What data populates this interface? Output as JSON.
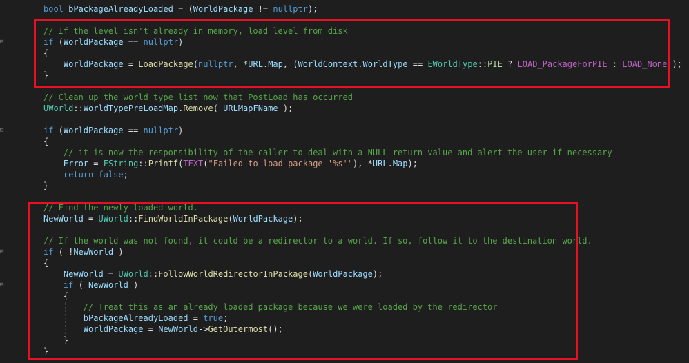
{
  "editor": {
    "highlight_color": "#e81123",
    "background_color": "#1e1e1e",
    "fold_icon": "fold-minus-icon",
    "lines": [
      {
        "tokens": [
          {
            "c": "kw",
            "t": "bool"
          },
          {
            "c": "pl",
            "t": " "
          },
          {
            "c": "id",
            "t": "bPackageAlreadyLoaded"
          },
          {
            "c": "pl",
            "t": " = ("
          },
          {
            "c": "id",
            "t": "WorldPackage"
          },
          {
            "c": "pl",
            "t": " != "
          },
          {
            "c": "kw",
            "t": "nullptr"
          },
          {
            "c": "pl",
            "t": ");"
          }
        ]
      },
      {
        "tokens": []
      },
      {
        "tokens": [
          {
            "c": "cm",
            "t": "// If the level isn't already in memory, load level from disk"
          }
        ]
      },
      {
        "tokens": [
          {
            "c": "kw",
            "t": "if"
          },
          {
            "c": "pl",
            "t": " ("
          },
          {
            "c": "id",
            "t": "WorldPackage"
          },
          {
            "c": "pl",
            "t": " == "
          },
          {
            "c": "kw",
            "t": "nullptr"
          },
          {
            "c": "pl",
            "t": ")"
          }
        ]
      },
      {
        "tokens": [
          {
            "c": "pl",
            "t": "{"
          }
        ]
      },
      {
        "tokens": [
          {
            "c": "pl",
            "t": "    "
          },
          {
            "c": "id",
            "t": "WorldPackage"
          },
          {
            "c": "pl",
            "t": " = "
          },
          {
            "c": "fn",
            "t": "LoadPackage"
          },
          {
            "c": "pl",
            "t": "("
          },
          {
            "c": "kw",
            "t": "nullptr"
          },
          {
            "c": "pl",
            "t": ", *"
          },
          {
            "c": "id",
            "t": "URL"
          },
          {
            "c": "pl",
            "t": "."
          },
          {
            "c": "id",
            "t": "Map"
          },
          {
            "c": "pl",
            "t": ", ("
          },
          {
            "c": "id",
            "t": "WorldContext"
          },
          {
            "c": "pl",
            "t": "."
          },
          {
            "c": "id",
            "t": "WorldType"
          },
          {
            "c": "pl",
            "t": " == "
          },
          {
            "c": "ty",
            "t": "EWorldType"
          },
          {
            "c": "pl",
            "t": "::"
          },
          {
            "c": "en",
            "t": "PIE"
          },
          {
            "c": "pl",
            "t": " ? "
          },
          {
            "c": "mc",
            "t": "LOAD_PackageForPIE"
          },
          {
            "c": "pl",
            "t": " : "
          },
          {
            "c": "mc",
            "t": "LOAD_None"
          },
          {
            "c": "pl",
            "t": "));"
          }
        ]
      },
      {
        "tokens": [
          {
            "c": "pl",
            "t": "}"
          }
        ]
      },
      {
        "tokens": []
      },
      {
        "tokens": [
          {
            "c": "cm",
            "t": "// Clean up the world type list now that PostLoad has occurred"
          }
        ]
      },
      {
        "tokens": [
          {
            "c": "ty",
            "t": "UWorld"
          },
          {
            "c": "pl",
            "t": "::"
          },
          {
            "c": "id",
            "t": "WorldTypePreLoadMap"
          },
          {
            "c": "pl",
            "t": "."
          },
          {
            "c": "fn",
            "t": "Remove"
          },
          {
            "c": "pl",
            "t": "( "
          },
          {
            "c": "id",
            "t": "URLMapFName"
          },
          {
            "c": "pl",
            "t": " );"
          }
        ]
      },
      {
        "tokens": []
      },
      {
        "tokens": [
          {
            "c": "kw",
            "t": "if"
          },
          {
            "c": "pl",
            "t": " ("
          },
          {
            "c": "id",
            "t": "WorldPackage"
          },
          {
            "c": "pl",
            "t": " == "
          },
          {
            "c": "kw",
            "t": "nullptr"
          },
          {
            "c": "pl",
            "t": ")"
          }
        ]
      },
      {
        "tokens": [
          {
            "c": "pl",
            "t": "{"
          }
        ]
      },
      {
        "tokens": [
          {
            "c": "pl",
            "t": "    "
          },
          {
            "c": "cm",
            "t": "// it is now the responsibility of the caller to deal with a NULL return value and alert the user if necessary"
          }
        ]
      },
      {
        "tokens": [
          {
            "c": "pl",
            "t": "    "
          },
          {
            "c": "id",
            "t": "Error"
          },
          {
            "c": "pl",
            "t": " = "
          },
          {
            "c": "ty",
            "t": "FString"
          },
          {
            "c": "pl",
            "t": "::"
          },
          {
            "c": "fn",
            "t": "Printf"
          },
          {
            "c": "pl",
            "t": "("
          },
          {
            "c": "mc",
            "t": "TEXT"
          },
          {
            "c": "pl",
            "t": "("
          },
          {
            "c": "st",
            "t": "\"Failed to load package '%s'\""
          },
          {
            "c": "pl",
            "t": "), *"
          },
          {
            "c": "id",
            "t": "URL"
          },
          {
            "c": "pl",
            "t": "."
          },
          {
            "c": "id",
            "t": "Map"
          },
          {
            "c": "pl",
            "t": ");"
          }
        ]
      },
      {
        "tokens": [
          {
            "c": "pl",
            "t": "    "
          },
          {
            "c": "kw",
            "t": "return"
          },
          {
            "c": "pl",
            "t": " "
          },
          {
            "c": "kw",
            "t": "false"
          },
          {
            "c": "pl",
            "t": ";"
          }
        ]
      },
      {
        "tokens": [
          {
            "c": "pl",
            "t": "}"
          }
        ]
      },
      {
        "tokens": []
      },
      {
        "tokens": [
          {
            "c": "cm",
            "t": "// Find the newly loaded world."
          }
        ]
      },
      {
        "tokens": [
          {
            "c": "id",
            "t": "NewWorld"
          },
          {
            "c": "pl",
            "t": " = "
          },
          {
            "c": "ty",
            "t": "UWorld"
          },
          {
            "c": "pl",
            "t": "::"
          },
          {
            "c": "fn",
            "t": "FindWorldInPackage"
          },
          {
            "c": "pl",
            "t": "("
          },
          {
            "c": "id",
            "t": "WorldPackage"
          },
          {
            "c": "pl",
            "t": ");"
          }
        ]
      },
      {
        "tokens": []
      },
      {
        "tokens": [
          {
            "c": "cm",
            "t": "// If the world was not found, it could be a redirector to a world. If so, follow it to the destination world."
          }
        ]
      },
      {
        "tokens": [
          {
            "c": "kw",
            "t": "if"
          },
          {
            "c": "pl",
            "t": " ( !"
          },
          {
            "c": "id",
            "t": "NewWorld"
          },
          {
            "c": "pl",
            "t": " )"
          }
        ]
      },
      {
        "tokens": [
          {
            "c": "pl",
            "t": "{"
          }
        ]
      },
      {
        "tokens": [
          {
            "c": "pl",
            "t": "    "
          },
          {
            "c": "id",
            "t": "NewWorld"
          },
          {
            "c": "pl",
            "t": " = "
          },
          {
            "c": "ty",
            "t": "UWorld"
          },
          {
            "c": "pl",
            "t": "::"
          },
          {
            "c": "fn",
            "t": "FollowWorldRedirectorInPackage"
          },
          {
            "c": "pl",
            "t": "("
          },
          {
            "c": "id",
            "t": "WorldPackage"
          },
          {
            "c": "pl",
            "t": ");"
          }
        ]
      },
      {
        "tokens": [
          {
            "c": "pl",
            "t": "    "
          },
          {
            "c": "kw",
            "t": "if"
          },
          {
            "c": "pl",
            "t": " ( "
          },
          {
            "c": "id",
            "t": "NewWorld"
          },
          {
            "c": "pl",
            "t": " )"
          }
        ]
      },
      {
        "tokens": [
          {
            "c": "pl",
            "t": "    {"
          }
        ]
      },
      {
        "tokens": [
          {
            "c": "pl",
            "t": "        "
          },
          {
            "c": "cm",
            "t": "// Treat this as an already loaded package because we were loaded by the redirector"
          }
        ]
      },
      {
        "tokens": [
          {
            "c": "pl",
            "t": "        "
          },
          {
            "c": "id",
            "t": "bPackageAlreadyLoaded"
          },
          {
            "c": "pl",
            "t": " = "
          },
          {
            "c": "kw",
            "t": "true"
          },
          {
            "c": "pl",
            "t": ";"
          }
        ]
      },
      {
        "tokens": [
          {
            "c": "pl",
            "t": "        "
          },
          {
            "c": "id",
            "t": "WorldPackage"
          },
          {
            "c": "pl",
            "t": " = "
          },
          {
            "c": "id",
            "t": "NewWorld"
          },
          {
            "c": "pl",
            "t": "->"
          },
          {
            "c": "fn",
            "t": "GetOutermost"
          },
          {
            "c": "pl",
            "t": "();"
          }
        ]
      },
      {
        "tokens": [
          {
            "c": "pl",
            "t": "    }"
          }
        ]
      },
      {
        "tokens": [
          {
            "c": "pl",
            "t": "}"
          }
        ]
      }
    ]
  }
}
